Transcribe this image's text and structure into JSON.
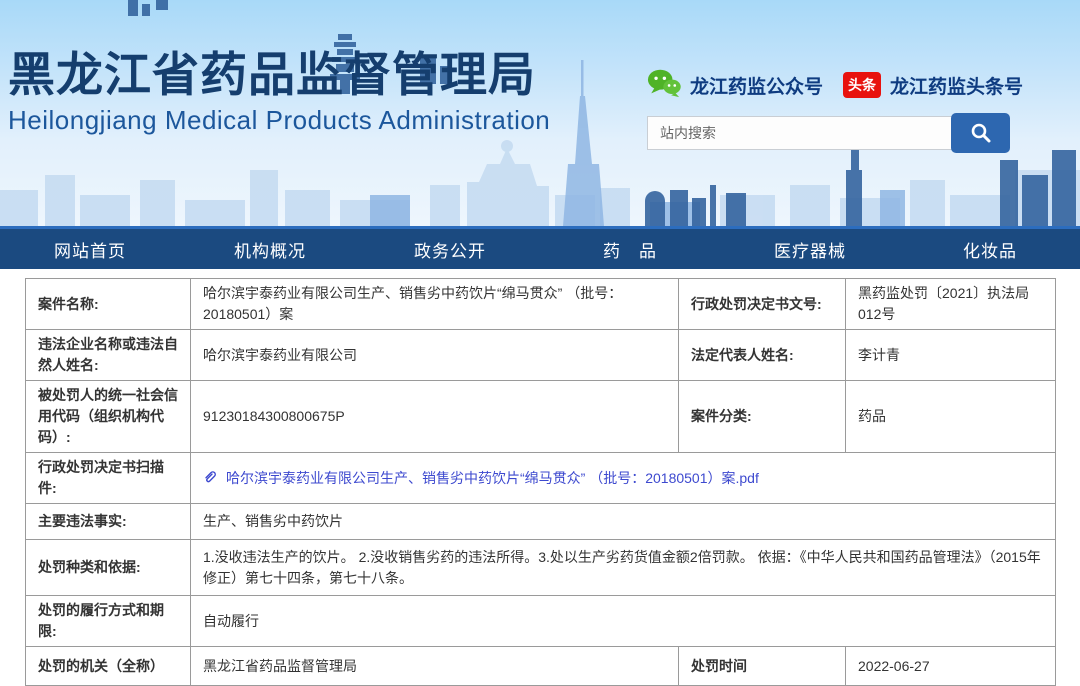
{
  "header": {
    "title": "黑龙江省药品监督管理局",
    "subtitle": "Heilongjiang Medical Products Administration",
    "wechat_label": "龙江药监公众号",
    "toutiao_badge": "头条",
    "toutiao_label": "龙江药监头条号",
    "search_placeholder": "站内搜索"
  },
  "nav": {
    "items": [
      "网站首页",
      "机构概况",
      "政务公开",
      "药　品",
      "医疗器械",
      "化妆品"
    ]
  },
  "table": {
    "rows": {
      "r1": {
        "l1": "案件名称:",
        "v1": "哈尔滨宇泰药业有限公司生产、销售劣中药饮片“绵马贯众” （批号：20180501）案",
        "l2": "行政处罚决定书文号:",
        "v2": "黑药监处罚〔2021〕执法局012号"
      },
      "r2": {
        "l1": "违法企业名称或违法自然人姓名:",
        "v1": "哈尔滨宇泰药业有限公司",
        "l2": "法定代表人姓名:",
        "v2": "李计青"
      },
      "r3": {
        "l1": "被处罚人的统一社会信用代码（组织机构代码）:",
        "v1": "91230184300800675P",
        "l2": "案件分类:",
        "v2": "药品"
      },
      "r4": {
        "l1": "行政处罚决定书扫描件:",
        "link": "哈尔滨宇泰药业有限公司生产、销售劣中药饮片“绵马贯众” （批号：20180501）案.pdf"
      },
      "r5": {
        "l1": "主要违法事实:",
        "v1": "生产、销售劣中药饮片"
      },
      "r6": {
        "l1": "处罚种类和依据:",
        "v1": "1.没收违法生产的饮片。 2.没收销售劣药的违法所得。3.处以生产劣药货值金额2倍罚款。 依据：《中华人民共和国药品管理法》（2015年修正）第七十四条，第七十八条。"
      },
      "r7": {
        "l1": "处罚的履行方式和期限:",
        "v1": "自动履行"
      },
      "r8": {
        "l1": "处罚的机关（全称）",
        "v1": "黑龙江省药品监督管理局",
        "l2": "处罚时间",
        "v2": "2022-06-27"
      }
    }
  },
  "colors": {
    "nav_bg": "#1b4a80",
    "nav_accent_line": "#2c6dbe",
    "title_blue": "#153e6e",
    "subtitle_blue": "#1c579c",
    "link_blue": "#3d49cf",
    "wechat_green": "#4fb327",
    "toutiao_red": "#e8120e",
    "search_button_blue": "#2d67b0"
  }
}
